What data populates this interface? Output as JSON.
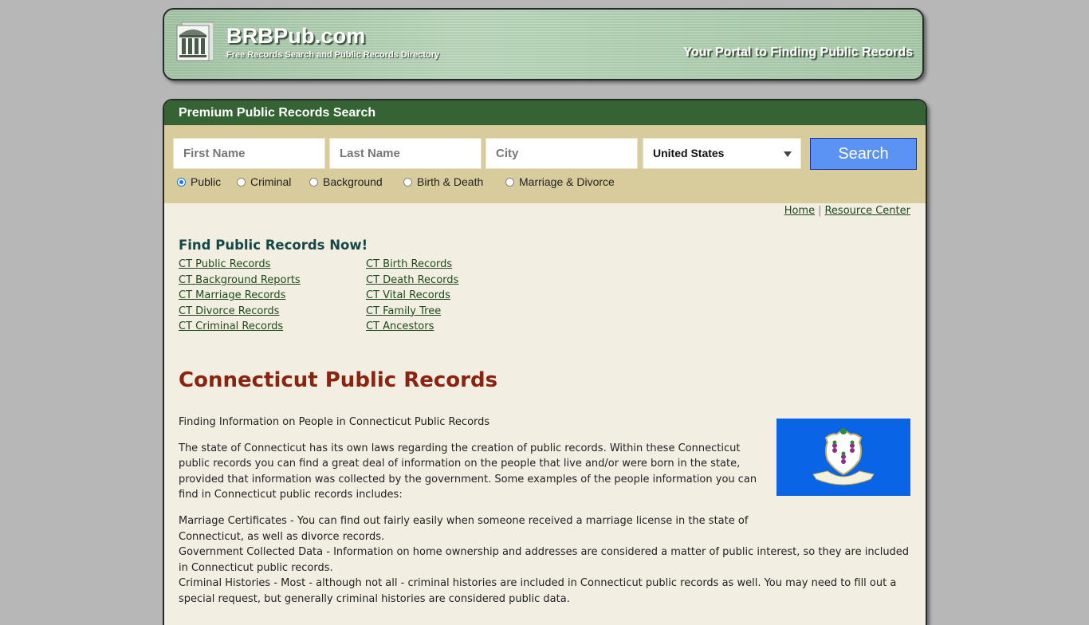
{
  "header": {
    "site_name": "BRBPub.com",
    "tagline": "Free Records Search and Public Records Directory",
    "slogan": "Your Portal to Finding Public Records",
    "logo_icon": "courthouse-icon"
  },
  "search": {
    "title": "Premium Public Records Search",
    "first_name_placeholder": "First Name",
    "last_name_placeholder": "Last Name",
    "city_placeholder": "City",
    "country_selected": "United States",
    "button_label": "Search",
    "button_color": "#5b93f5",
    "record_types": [
      {
        "label": "Public",
        "checked": true
      },
      {
        "label": "Criminal",
        "checked": false
      },
      {
        "label": "Background",
        "checked": false
      },
      {
        "label": "Birth & Death",
        "checked": false
      },
      {
        "label": "Marriage & Divorce",
        "checked": false
      }
    ]
  },
  "nav": {
    "home": "Home",
    "separator": "|",
    "resource_center": "Resource Center"
  },
  "find": {
    "title": "Find Public Records Now!",
    "col1": [
      "CT Public Records",
      "CT Background Reports",
      "CT Marriage Records",
      "CT Divorce Records",
      "CT Criminal Records"
    ],
    "col2": [
      "CT Birth Records",
      "CT Death Records",
      "CT Vital Records",
      "CT Family Tree",
      "CT Ancestors"
    ]
  },
  "main": {
    "title": "Connecticut Public Records",
    "intro": "Finding Information on People in Connecticut Public Records",
    "paragraph": "The state of Connecticut has its own laws regarding the creation of public records. Within these Connecticut public records you can find a great deal of information on the people that live and/or were born in the state, provided that information was collected by the government. Some examples of the people information you can find in Connecticut public records includes:",
    "items": [
      "Marriage Certificates - You can find out fairly easily when someone received a marriage license in the state of Connecticut, as well as divorce records.",
      "Government Collected Data - Information on home ownership and addresses are considered a matter of public interest, so they are included in Connecticut public records.",
      "Criminal Histories - Most - although not all - criminal histories are included in Connecticut public records as well. You may need to fill out a special request, but generally criminal histories are considered public data."
    ],
    "flag_alt": "Connecticut state flag"
  },
  "colors": {
    "search_header": "#356334",
    "search_area": "#d8cc9c",
    "page_bg": "#f2eee1",
    "title": "#8b2311",
    "link": "#1f4a1f"
  }
}
